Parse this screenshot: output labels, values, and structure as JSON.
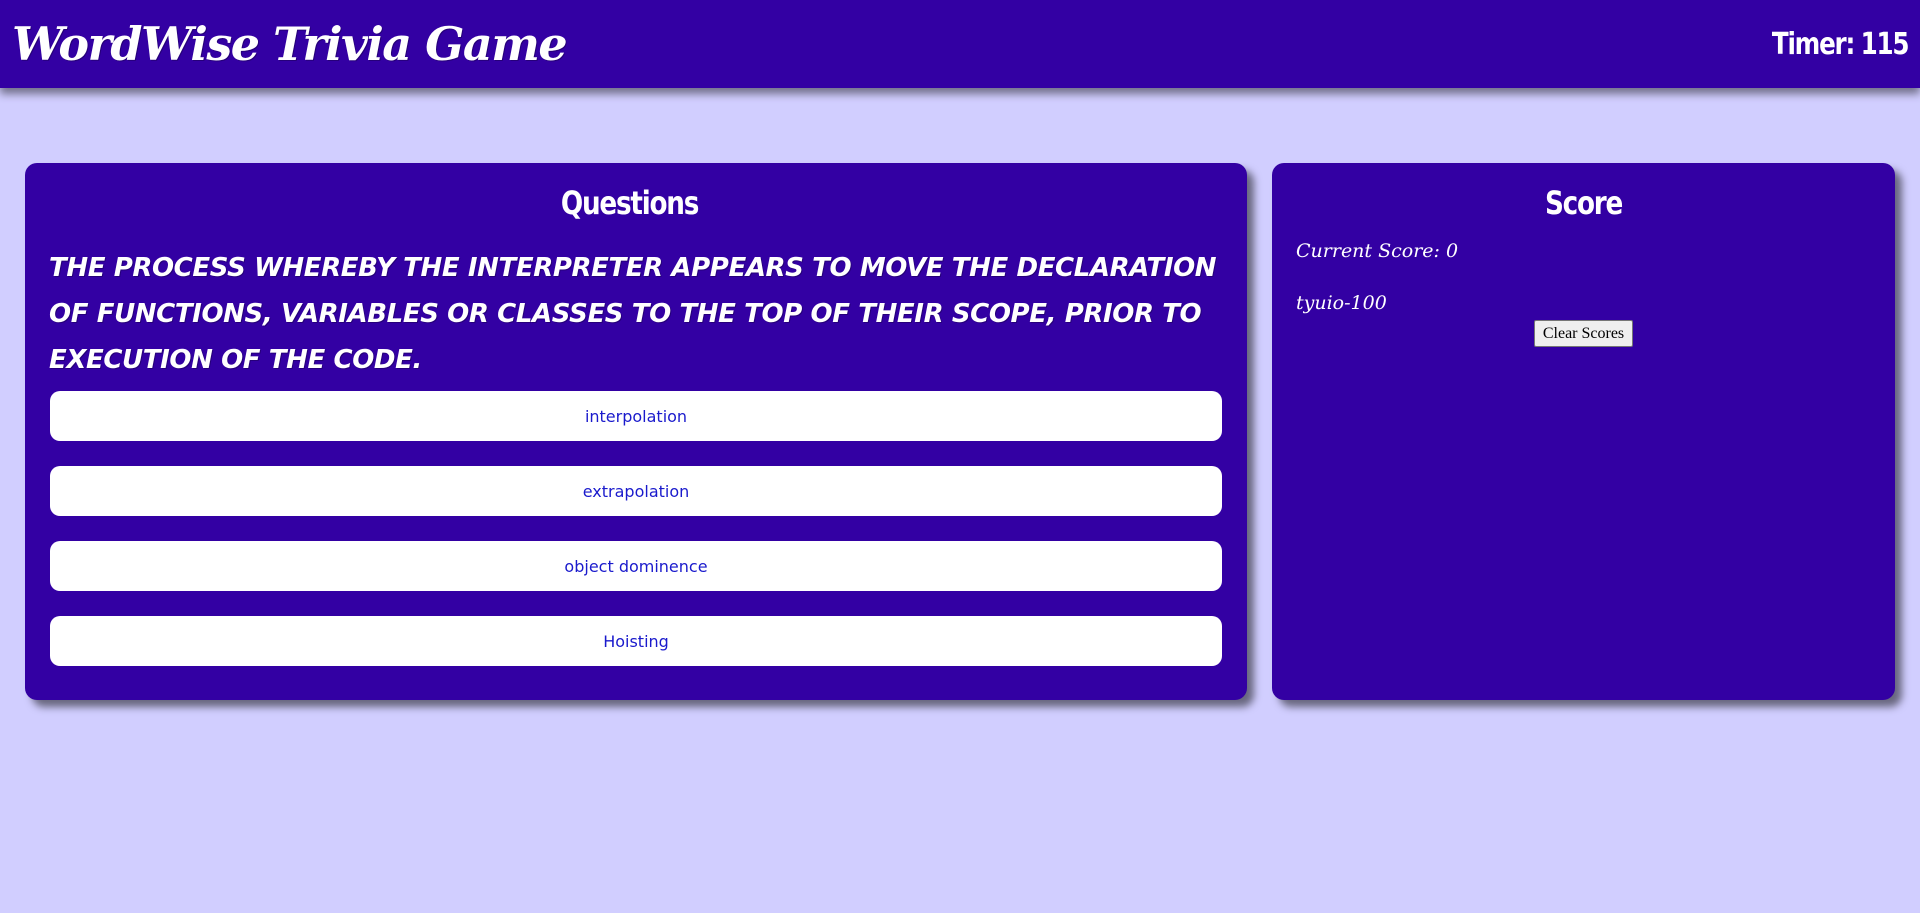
{
  "header": {
    "app_title": "WordWise Trivia Game",
    "timer_label": "Timer:",
    "timer_value": "115"
  },
  "questions_panel": {
    "heading": "Questions",
    "question": "The process whereby the interpreter appears to move the declaration of functions, variables or classes to the top of their scope, prior to execution of the code.",
    "answers": [
      {
        "label": "interpolation"
      },
      {
        "label": "extrapolation"
      },
      {
        "label": "object dominence"
      },
      {
        "label": "Hoisting"
      }
    ]
  },
  "score_panel": {
    "heading": "Score",
    "current_score_label": "Current Score:",
    "current_score_value": "0",
    "high_scores": [
      "tyuio-100"
    ],
    "clear_button_label": "Clear Scores"
  },
  "colors": {
    "background": "#d1ceff",
    "panel": "#3300a3",
    "answer_text": "#1a1acc"
  }
}
